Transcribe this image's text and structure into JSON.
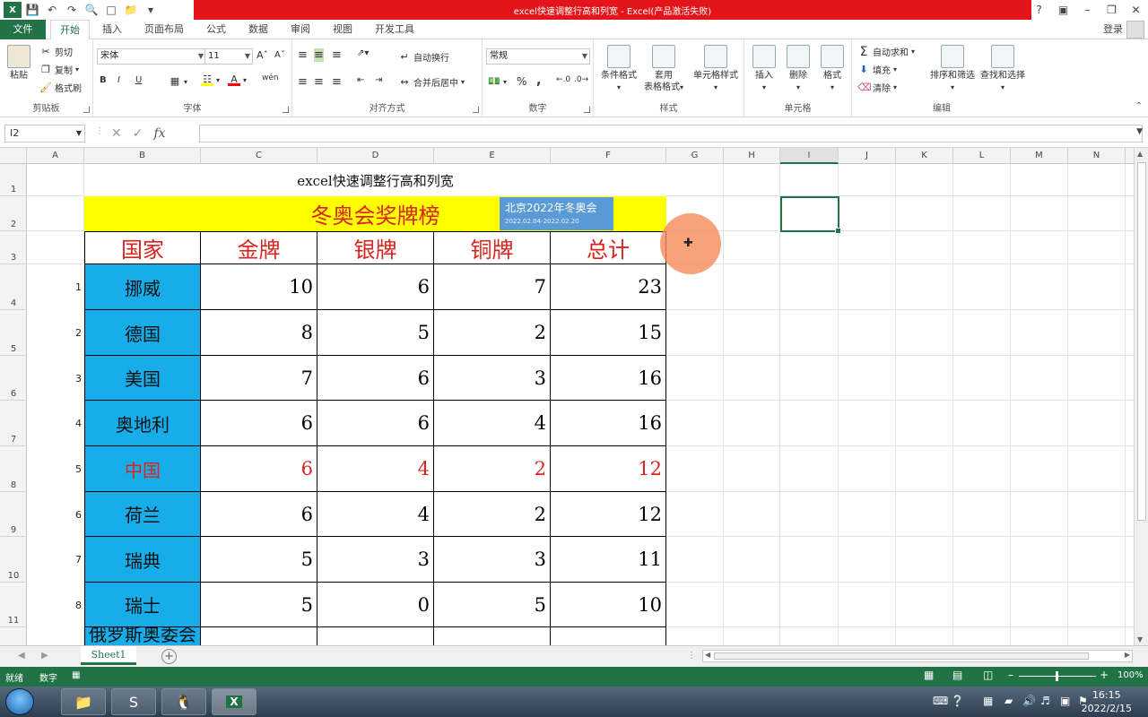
{
  "window": {
    "title": "excel快速调整行高和列宽 - Excel(产品激活失败)",
    "login": "登录"
  },
  "ribbon_tabs": [
    "文件",
    "开始",
    "插入",
    "页面布局",
    "公式",
    "数据",
    "审阅",
    "视图",
    "开发工具"
  ],
  "clipboard": {
    "label": "剪贴板",
    "paste": "粘贴",
    "cut": "剪切",
    "copy": "复制",
    "format_painter": "格式刷"
  },
  "font": {
    "label": "字体",
    "name": "宋体",
    "size": "11",
    "bold": "B",
    "italic": "I",
    "underline": "U"
  },
  "alignment": {
    "label": "对齐方式",
    "wrap": "自动换行",
    "merge": "合并后居中"
  },
  "number": {
    "label": "数字",
    "format": "常规",
    "percent": "%",
    "comma": ","
  },
  "styles": {
    "label": "样式",
    "conditional": "条件格式",
    "table_l1": "套用",
    "table_l2": "表格格式",
    "cell_styles": "单元格样式"
  },
  "cells_group": {
    "label": "单元格",
    "insert": "插入",
    "delete": "删除",
    "format": "格式"
  },
  "editing": {
    "label": "编辑",
    "autosum": "自动求和",
    "fill": "填充",
    "clear": "清除",
    "sort_filter": "排序和筛选",
    "find_select": "查找和选择"
  },
  "formula_bar": {
    "name_box": "I2",
    "formula": ""
  },
  "columns": [
    "A",
    "B",
    "C",
    "D",
    "E",
    "F",
    "G",
    "H",
    "I",
    "J",
    "K",
    "L",
    "M",
    "N"
  ],
  "rows": [
    "1",
    "2",
    "3",
    "4",
    "5",
    "6",
    "7",
    "8",
    "9",
    "10",
    "11"
  ],
  "sheet": {
    "title": "excel快速调整行高和列宽",
    "banner": "冬奥会奖牌榜",
    "headers": [
      "国家",
      "金牌",
      "银牌",
      "铜牌",
      "总计"
    ],
    "data": [
      {
        "rank": "1",
        "country": "挪威",
        "gold": "10",
        "silver": "6",
        "bronze": "7",
        "total": "23"
      },
      {
        "rank": "2",
        "country": "德国",
        "gold": "8",
        "silver": "5",
        "bronze": "2",
        "total": "15"
      },
      {
        "rank": "3",
        "country": "美国",
        "gold": "7",
        "silver": "6",
        "bronze": "3",
        "total": "16"
      },
      {
        "rank": "4",
        "country": "奥地利",
        "gold": "6",
        "silver": "6",
        "bronze": "4",
        "total": "16"
      },
      {
        "rank": "5",
        "country": "中国",
        "gold": "6",
        "silver": "4",
        "bronze": "2",
        "total": "12"
      },
      {
        "rank": "6",
        "country": "荷兰",
        "gold": "6",
        "silver": "4",
        "bronze": "2",
        "total": "12"
      },
      {
        "rank": "7",
        "country": "瑞典",
        "gold": "5",
        "silver": "3",
        "bronze": "3",
        "total": "11"
      },
      {
        "rank": "8",
        "country": "瑞士",
        "gold": "5",
        "silver": "0",
        "bronze": "5",
        "total": "10"
      }
    ],
    "partial_row_country": "俄罗斯奥委会"
  },
  "tooltip": {
    "line1": "北京2022年冬奥会",
    "line2": "2022.02.04-2022.02.20"
  },
  "sheet_tab": "Sheet1",
  "status": {
    "ready": "就绪",
    "numlock": "数字",
    "zoom": "100%"
  },
  "clock": {
    "time": "16:15",
    "date": "2022/2/15"
  },
  "colors": {
    "excel_green": "#217346",
    "title_red": "#e3151a",
    "country_blue": "#17adeb",
    "banner_yellow": "#ffff00",
    "header_red": "#d8241c"
  }
}
